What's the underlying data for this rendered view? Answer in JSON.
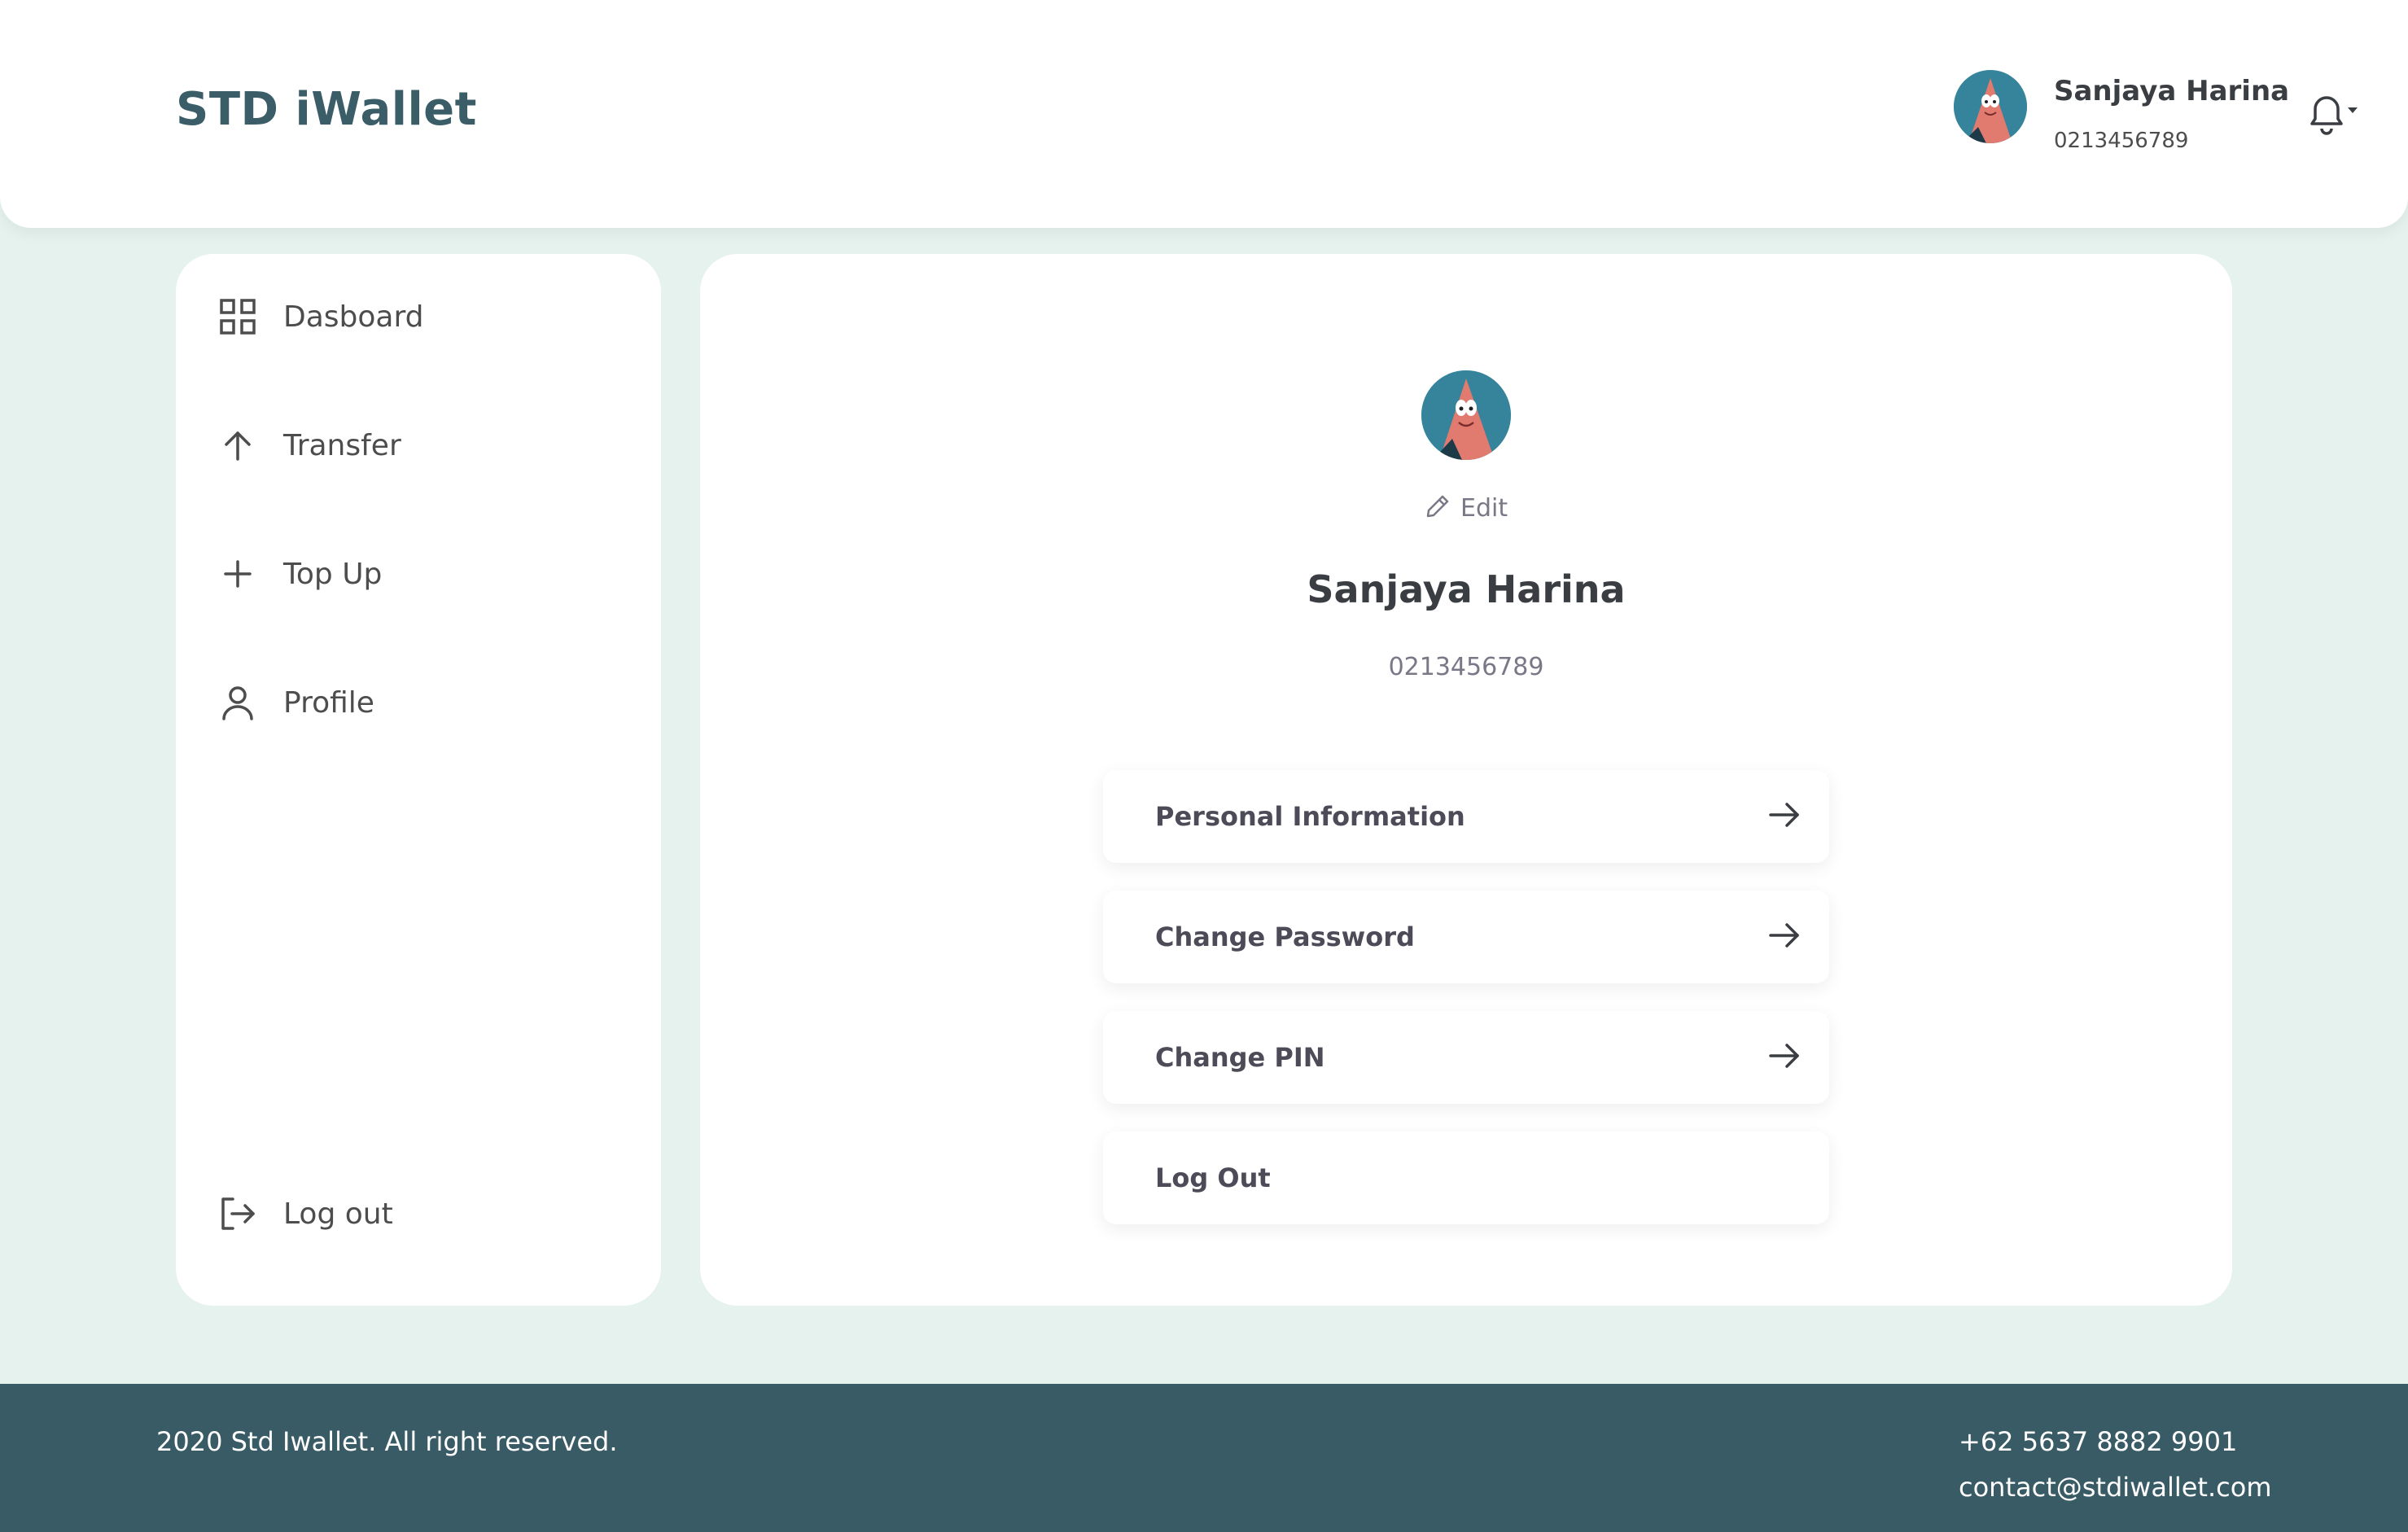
{
  "header": {
    "brand": "STD iWallet",
    "user_name": "Sanjaya Harina",
    "user_phone": "0213456789"
  },
  "sidebar": {
    "items": [
      {
        "label": "Dasboard",
        "icon": "grid-icon"
      },
      {
        "label": "Transfer",
        "icon": "arrow-up-icon"
      },
      {
        "label": "Top Up",
        "icon": "plus-icon"
      },
      {
        "label": "Profile",
        "icon": "user-icon"
      }
    ],
    "logout_label": "Log out"
  },
  "profile": {
    "edit_label": "Edit",
    "name": "Sanjaya Harina",
    "phone": "0213456789",
    "menu": [
      {
        "label": "Personal Information",
        "has_arrow": true
      },
      {
        "label": "Change Password",
        "has_arrow": true
      },
      {
        "label": "Change PIN",
        "has_arrow": true
      },
      {
        "label": "Log Out",
        "has_arrow": false
      }
    ]
  },
  "footer": {
    "copyright": "2020 Std Iwallet. All right reserved.",
    "phone": "+62 5637 8882 9901",
    "email": "contact@stdiwallet.com"
  },
  "colors": {
    "brand": "#3a5d68",
    "background": "#e5f2ee",
    "footer": "#385b65"
  }
}
